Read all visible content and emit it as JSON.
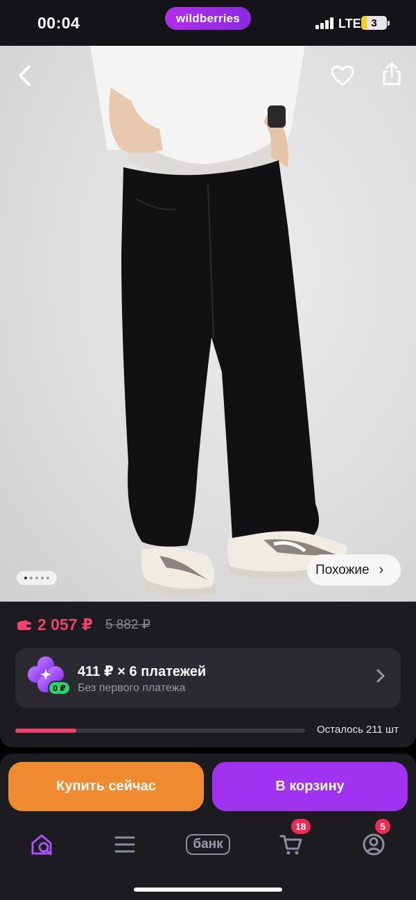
{
  "status_bar": {
    "time": "00:04",
    "network": "LTE",
    "battery": "3"
  },
  "brand": {
    "name": "wildberries"
  },
  "product": {
    "similar_label": "Похожие",
    "pager": {
      "total": 5,
      "active": 1
    },
    "price": "2 057 ₽",
    "old_price": "5 882 ₽",
    "installment": {
      "title": "411 ₽ × 6 платежей",
      "subtitle": "Без первого платежа",
      "badge": "0 ₽"
    },
    "stock": {
      "text": "Осталось 211 шт",
      "fill_fraction": 0.21
    }
  },
  "actions": {
    "buy_now": "Купить сейчас",
    "add_to_cart": "В корзину"
  },
  "tab_bar": {
    "bank_label": "банк",
    "cart_badge": "18",
    "profile_badge": "5"
  },
  "colors": {
    "accent_price": "#f1416c",
    "buy_button": "#f08a31",
    "cart_button": "#a032f0",
    "brand": "#a22ee8",
    "badge": "#f12a55",
    "zero_badge": "#2bd16b"
  }
}
